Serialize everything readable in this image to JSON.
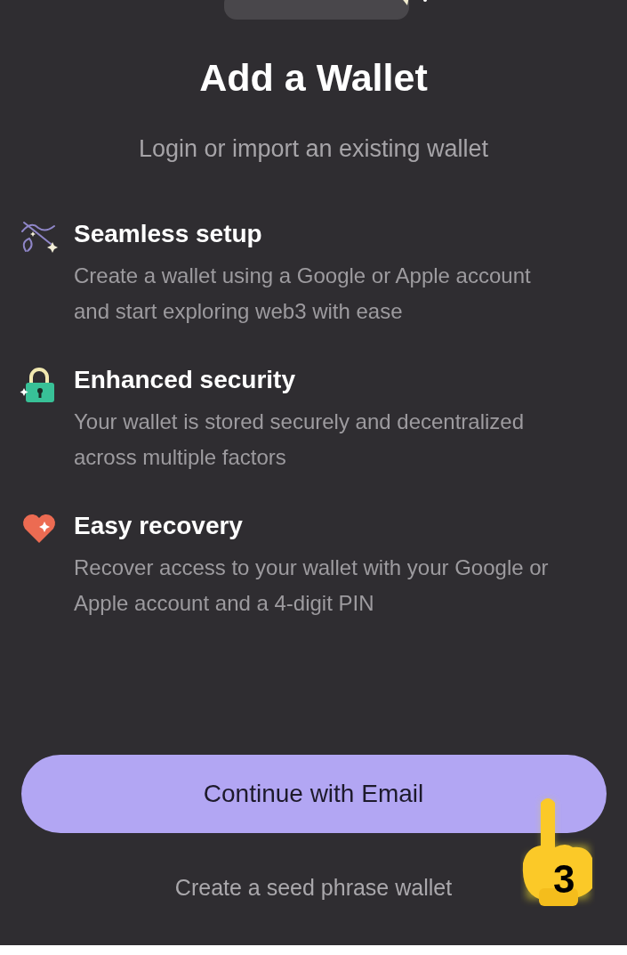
{
  "title": "Add a Wallet",
  "subtitle": "Login or import an existing wallet",
  "features": [
    {
      "title": "Seamless setup",
      "description": "Create a wallet using a Google or Apple account and start exploring web3 with ease"
    },
    {
      "title": "Enhanced security",
      "description": "Your wallet is stored securely and decentralized across multiple factors"
    },
    {
      "title": "Easy recovery",
      "description": "Recover access to your wallet with your Google or Apple account and a 4-digit PIN"
    }
  ],
  "primary_button": "Continue with Email",
  "secondary_link": "Create a seed phrase wallet",
  "step_marker": "3"
}
